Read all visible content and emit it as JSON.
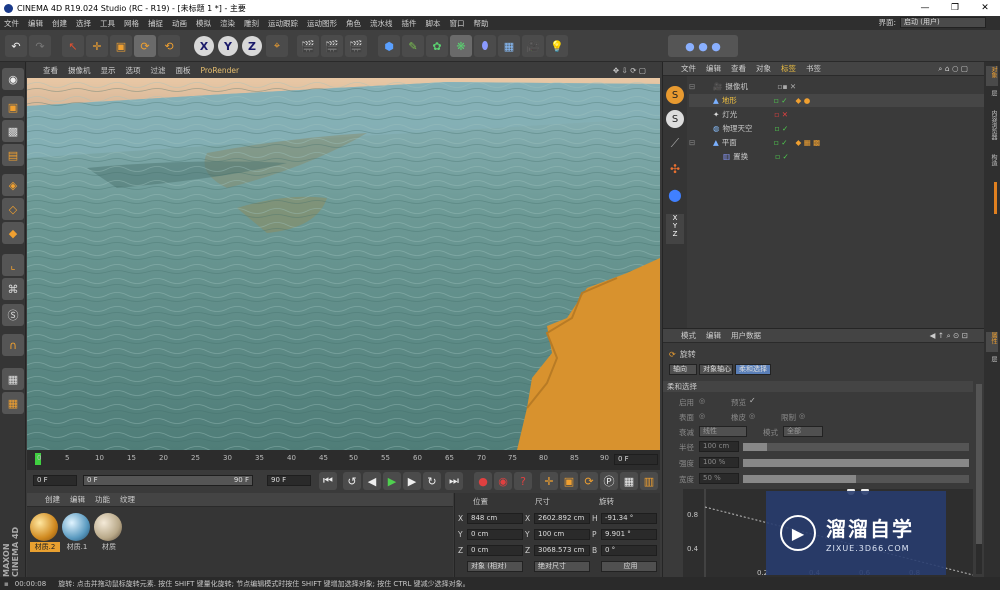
{
  "titlebar": {
    "title": "CINEMA 4D R19.024 Studio (RC - R19) - [未标题 1 *] - 主要",
    "minimize": "—",
    "maximize": "❐",
    "close": "✕"
  },
  "menubar": {
    "items": [
      "文件",
      "编辑",
      "创建",
      "选择",
      "工具",
      "网格",
      "捕捉",
      "动画",
      "模拟",
      "渲染",
      "雕刻",
      "运动跟踪",
      "运动图形",
      "角色",
      "流水线",
      "插件",
      "脚本",
      "窗口",
      "帮助"
    ],
    "layout_label": "界面:",
    "layout_value": "启动 (用户)"
  },
  "viewport_menu": {
    "items": [
      "查看",
      "摄像机",
      "显示",
      "选项",
      "过滤",
      "面板"
    ],
    "prorender": "ProRender"
  },
  "timeline": {
    "ticks": [
      "0",
      "5",
      "10",
      "15",
      "20",
      "25",
      "30",
      "35",
      "40",
      "45",
      "50",
      "55",
      "60",
      "65",
      "70",
      "75",
      "80",
      "85",
      "90"
    ],
    "current_frame": "0 F"
  },
  "transport": {
    "start": "0 F",
    "range_start": "0 F",
    "range_end": "90 F",
    "end": "90 F"
  },
  "material_panel": {
    "tabs": [
      "创建",
      "编辑",
      "功能",
      "纹理"
    ],
    "materials": [
      "材质.2",
      "材质.1",
      "材质"
    ]
  },
  "coord_panel": {
    "headers": [
      "位置",
      "尺寸",
      "旋转"
    ],
    "rows": [
      {
        "axis": "X",
        "pos": "848 cm",
        "size": "2602.892 cm",
        "rot_axis": "H",
        "rot": "-91.34 °"
      },
      {
        "axis": "Y",
        "pos": "0 cm",
        "size": "100 cm",
        "rot_axis": "P",
        "rot": "9.901 °"
      },
      {
        "axis": "Z",
        "pos": "0 cm",
        "size": "3068.573 cm",
        "rot_axis": "B",
        "rot": "0 °"
      }
    ],
    "mode_drop": "对象 (相对)",
    "size_drop": "绝对尺寸",
    "apply": "应用"
  },
  "object_panel": {
    "tabs": [
      "文件",
      "编辑",
      "查看",
      "对象",
      "标签",
      "书签"
    ],
    "objects": [
      {
        "name": "摄像机",
        "color": "#c8c8c8"
      },
      {
        "name": "地形",
        "color": "#f0c040"
      },
      {
        "name": "灯光",
        "color": "#c8c8c8"
      },
      {
        "name": "物理天空",
        "color": "#c8c8c8"
      },
      {
        "name": "平面",
        "color": "#c8c8c8"
      },
      {
        "name": "置换",
        "color": "#c8c8c8"
      }
    ]
  },
  "attr_panel": {
    "tabs": [
      "模式",
      "编辑",
      "用户数据"
    ],
    "object_name": "旋转",
    "subtabs": [
      "轴向",
      "对象轴心",
      "柔和选择"
    ],
    "section": "柔和选择",
    "options": {
      "enable": "启用",
      "preview": "预览",
      "surface": "表面",
      "rubber": "橡皮",
      "limit": "限制",
      "mode_label": "衰减",
      "mode_value": "线性",
      "mode2_label": "模式",
      "mode2_value": "全部",
      "radius_label": "半径",
      "radius_value": "100 cm",
      "strength_label": "强度",
      "strength_value": "100 %",
      "width_label": "宽度",
      "width_value": "50 %"
    },
    "graph_labels": [
      "0.8",
      "0.4",
      "0.2",
      "0.4",
      "0.6",
      "0.8"
    ]
  },
  "right_strip": [
    "对象",
    "内容浏览器",
    "构造",
    "层",
    "属性",
    "层"
  ],
  "statusbar": {
    "time": "00:00:08",
    "message": "旋转: 点击并拖动鼠标旋转元素. 按住 SHIFT 键量化旋转; 节点编辑模式时按住 SHIFT 键增加选择对象; 按住 CTRL 键减少选择对象。"
  },
  "watermark": {
    "title": "溜溜自学",
    "url": "ZIXUE.3D66.COM"
  },
  "brand": "MAXON CINEMA 4D",
  "colors": {
    "accent": "#f0a030",
    "sand": "#d8922e",
    "water": "#5e8a85"
  }
}
